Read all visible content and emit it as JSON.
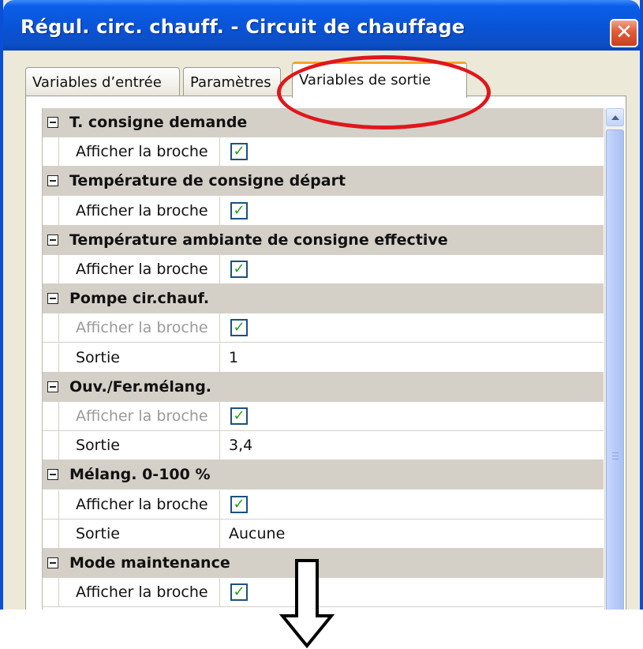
{
  "window": {
    "title": "Régul. circ. chauff. - Circuit de chauffage",
    "close_symbol": "✕"
  },
  "tabs": [
    {
      "label": "Variables d’entrée",
      "active": false
    },
    {
      "label": "Paramètres",
      "active": false
    },
    {
      "label": "Variables de sortie",
      "active": true
    }
  ],
  "groups": [
    {
      "title": "T. consigne demande",
      "rows": [
        {
          "name": "Afficher la broche",
          "type": "checkbox",
          "checked": true,
          "disabled": false
        }
      ]
    },
    {
      "title": "Température de consigne départ",
      "rows": [
        {
          "name": "Afficher la broche",
          "type": "checkbox",
          "checked": true,
          "disabled": false
        }
      ]
    },
    {
      "title": "Température ambiante de consigne effective",
      "rows": [
        {
          "name": "Afficher la broche",
          "type": "checkbox",
          "checked": true,
          "disabled": false
        }
      ]
    },
    {
      "title": "Pompe cir.chauf.",
      "rows": [
        {
          "name": "Afficher la broche",
          "type": "checkbox",
          "checked": true,
          "disabled": true
        },
        {
          "name": "Sortie",
          "type": "text",
          "value": "1",
          "disabled": false
        }
      ]
    },
    {
      "title": "Ouv./Fer.mélang.",
      "rows": [
        {
          "name": "Afficher la broche",
          "type": "checkbox",
          "checked": true,
          "disabled": true
        },
        {
          "name": "Sortie",
          "type": "text",
          "value": "3,4",
          "disabled": false
        }
      ]
    },
    {
      "title": "Mélang. 0-100 %",
      "rows": [
        {
          "name": "Afficher la broche",
          "type": "checkbox",
          "checked": true,
          "disabled": false
        },
        {
          "name": "Sortie",
          "type": "text",
          "value": "Aucune",
          "disabled": false
        }
      ]
    },
    {
      "title": "Mode maintenance",
      "rows": [
        {
          "name": "Afficher la broche",
          "type": "checkbox",
          "checked": true,
          "disabled": false
        }
      ]
    }
  ],
  "icons": {
    "expander": "minus-box-icon",
    "checkbox_mark": "✓",
    "scroll_up": "chevron-up-icon",
    "annotation_arrow": "down-arrow-icon"
  },
  "colors": {
    "titlebar": "#0a53d6",
    "tab_highlight": "#f5a623",
    "group_header": "#d4d0c8",
    "checkmark": "#21a121",
    "annotation": "#e0161c"
  }
}
